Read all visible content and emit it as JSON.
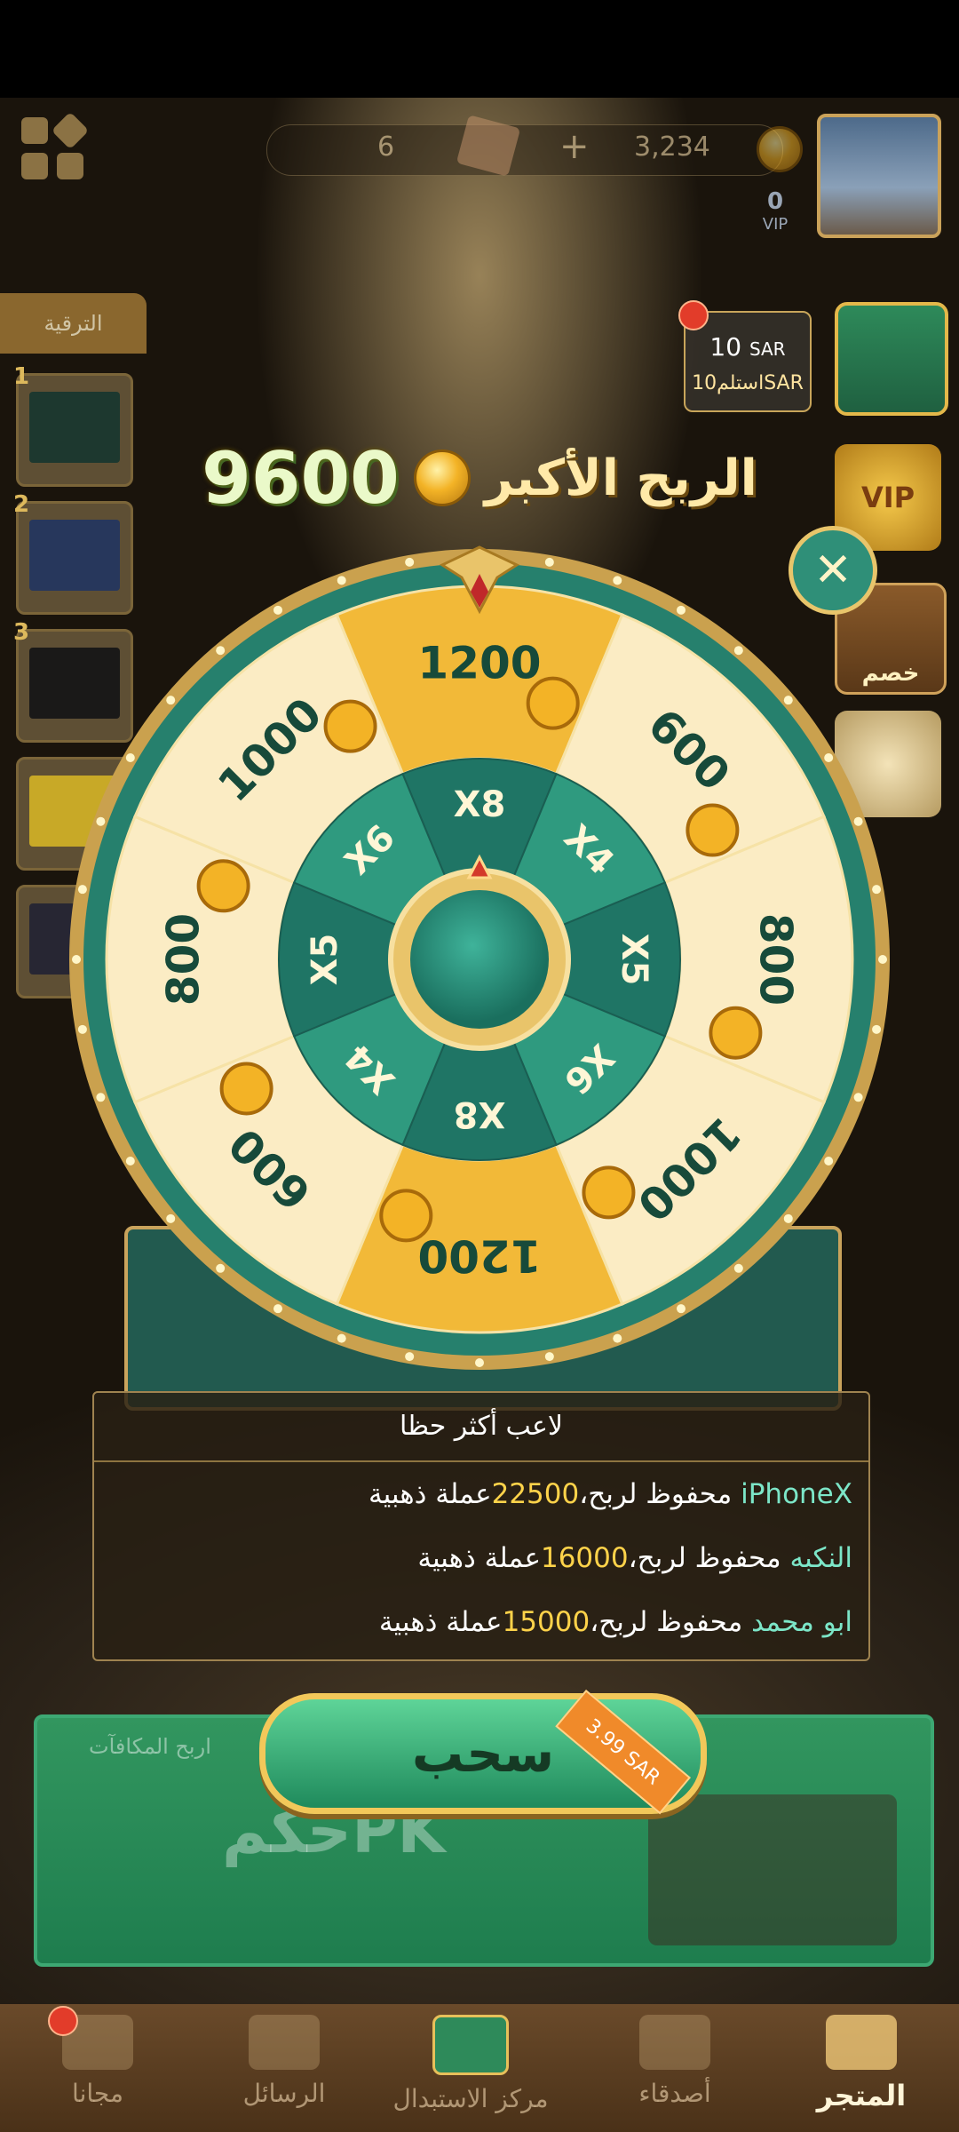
{
  "header": {
    "cards_count": "6",
    "gold": "3,234",
    "plus": "+",
    "vip_level": "0",
    "vip_text": "VIP"
  },
  "sidebar": {
    "tab_label": "الترقية",
    "ranks": [
      "1",
      "2",
      "3"
    ]
  },
  "right_rail": {
    "amazon_amount": "10",
    "amazon_unit": "SAR",
    "receive_label": "استلم10SAR",
    "discount_label": "خصم",
    "vip_label": "VIP"
  },
  "bigwin": {
    "title": "الربح الأكبر",
    "amount": "9600"
  },
  "wheel": {
    "outer": [
      "1200",
      "600",
      "800",
      "1000",
      "1200",
      "600",
      "800",
      "1000"
    ],
    "inner": [
      "X8",
      "X4",
      "X5",
      "X6",
      "X8",
      "X4",
      "X5",
      "X6"
    ]
  },
  "winners": {
    "title": "لاعب أكثر حظا",
    "rows": [
      {
        "name": "iPhoneX",
        "mid": " محفوظ لربح،",
        "amount": "22500",
        "unit": "عملة ذهبية"
      },
      {
        "name": "النكبه",
        "mid": " محفوظ لربح،",
        "amount": "16000",
        "unit": "عملة ذهبية"
      },
      {
        "name": "ابو محمد",
        "mid": "  محفوظ لربح،",
        "amount": "15000",
        "unit": "عملة ذهبية"
      }
    ]
  },
  "draw": {
    "label": "سحب",
    "price": "3.99 SAR"
  },
  "background_panel": {
    "rewards_text": "اربح المكافآت",
    "game_title": "حكمPK"
  },
  "navbar": {
    "items": [
      {
        "label": "مجانا",
        "icon": "gift-icon"
      },
      {
        "label": "الرسائل",
        "icon": "mail-icon"
      },
      {
        "label": "مركز الاستبدال",
        "icon": "exchange-center-icon"
      },
      {
        "label": "أصدقاء",
        "icon": "friends-icon"
      },
      {
        "label": "المتجر",
        "icon": "shop-cart-icon"
      }
    ]
  },
  "colors": {
    "accent_green": "#1f8a5c",
    "gold": "#f2c85a",
    "winner_name": "#7ce6c8",
    "winner_amount": "#ffd34a"
  }
}
